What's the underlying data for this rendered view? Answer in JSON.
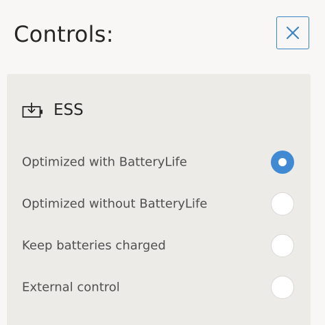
{
  "header": {
    "title": "Controls:",
    "close_icon": "close-icon"
  },
  "section": {
    "title": "ESS",
    "icon": "battery-download-icon",
    "options": [
      {
        "label": "Optimized with BatteryLife",
        "selected": true
      },
      {
        "label": "Optimized without BatteryLife",
        "selected": false
      },
      {
        "label": "Keep batteries charged",
        "selected": false
      },
      {
        "label": "External control",
        "selected": false
      }
    ]
  },
  "colors": {
    "accent": "#3f8ad2",
    "close_border": "#3a83c5",
    "page_bg": "#f8f7f5",
    "panel_bg": "#ecebe8"
  }
}
